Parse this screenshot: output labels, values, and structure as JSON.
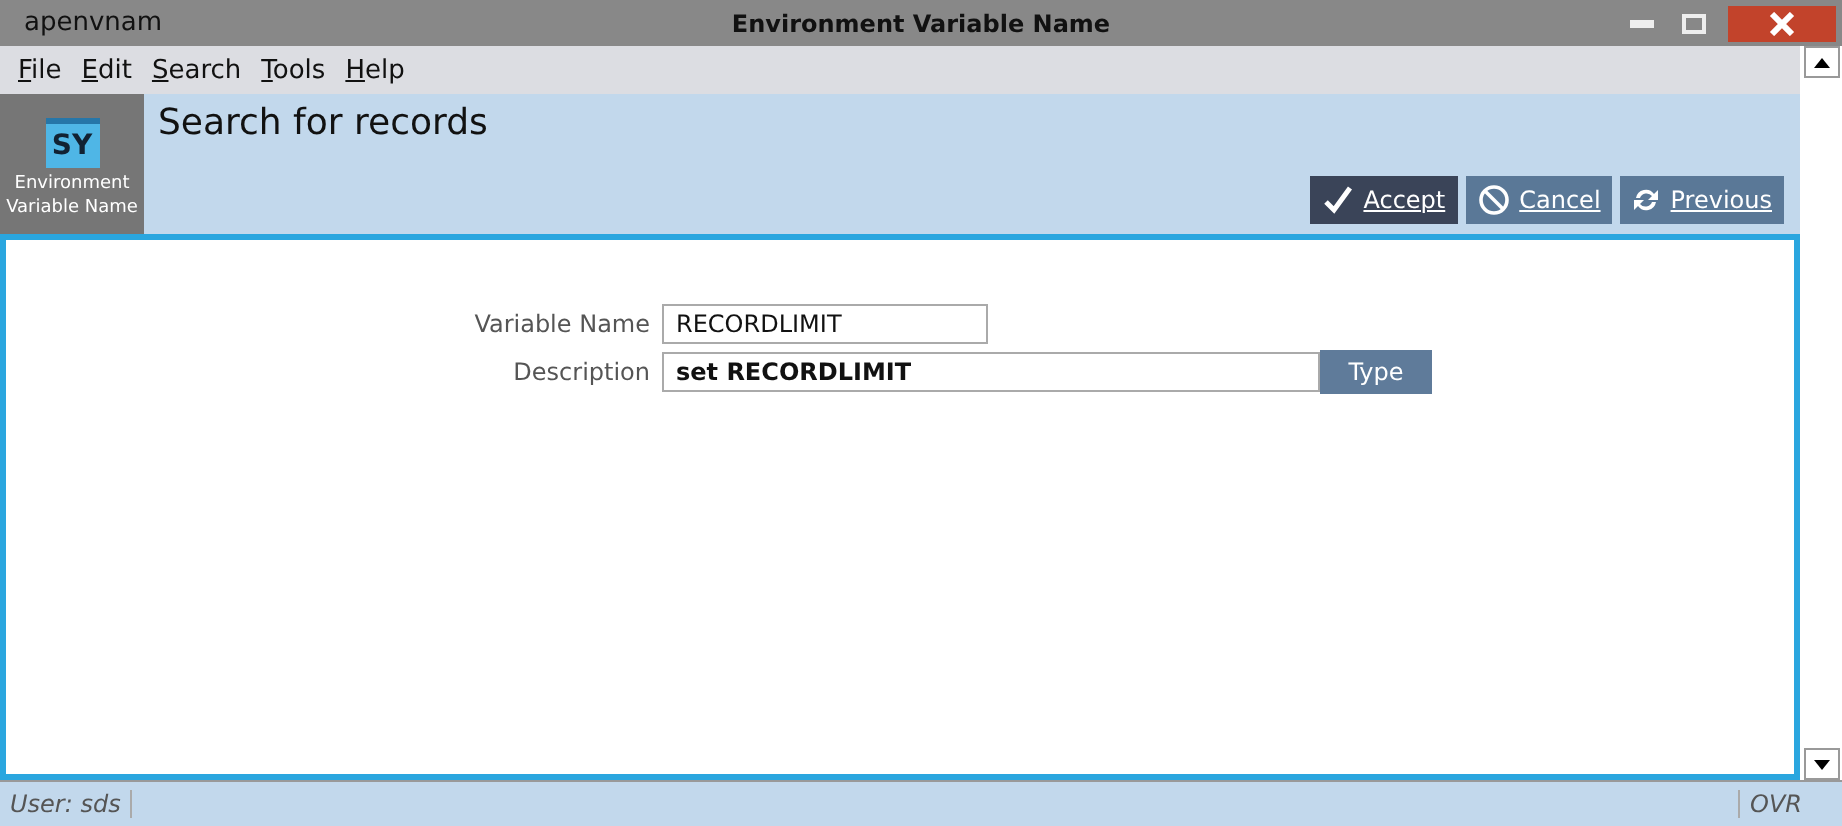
{
  "window": {
    "app": "apenvnam",
    "title": "Environment Variable Name"
  },
  "menu": [
    "File",
    "Edit",
    "Search",
    "Tools",
    "Help"
  ],
  "module": {
    "badge": "SY",
    "label": "Environment Variable Name"
  },
  "heading": "Search for records",
  "actions": [
    {
      "kind": "accept",
      "label": "Accept",
      "selected": true
    },
    {
      "kind": "cancel",
      "label": "Cancel",
      "selected": false
    },
    {
      "kind": "previous",
      "label": "Previous",
      "selected": false
    }
  ],
  "form": [
    {
      "label": "Variable Name",
      "value": "RECORDLIMIT",
      "bold": false,
      "wide": false
    },
    {
      "label": "Description",
      "value": "set RECORDLIMIT",
      "bold": true,
      "wide": true,
      "button": "Type"
    }
  ],
  "status_bar": {
    "user": "User: sds",
    "mode": "OVR"
  }
}
